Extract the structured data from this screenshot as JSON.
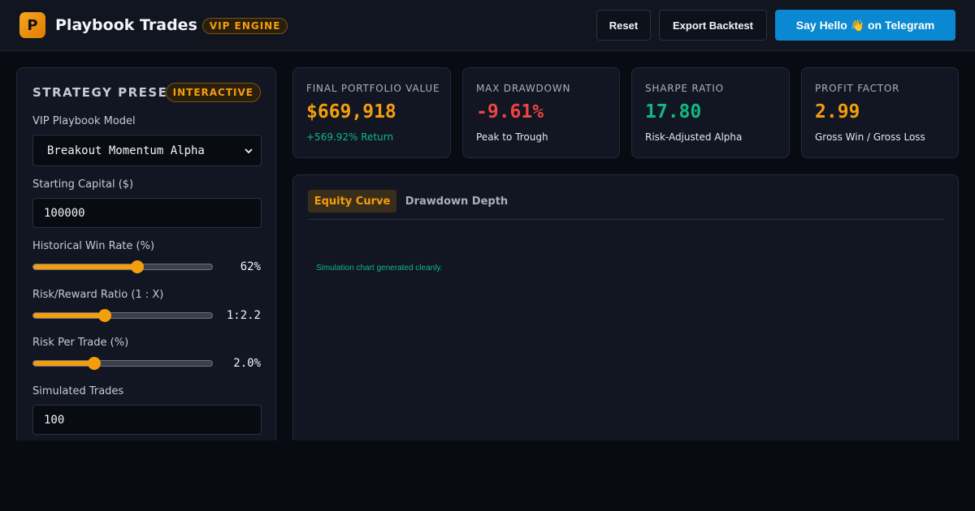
{
  "header": {
    "logo_letter": "P",
    "title": "Playbook Trades",
    "badge": "VIP ENGINE",
    "reset_label": "Reset",
    "export_label": "Export Backtest",
    "telegram_label": "Say Hello 👋 on Telegram"
  },
  "colors": {
    "accent": "#f59e0b",
    "positive": "#10b981",
    "negative": "#ef4444",
    "telegram": "#0a88d1"
  },
  "strategy": {
    "title": "STRATEGY PRESET",
    "badge": "INTERACTIVE",
    "model_label": "VIP Playbook Model",
    "model_value": "Breakout Momentum Alpha",
    "capital_label": "Starting Capital ($)",
    "capital_value": "100000",
    "win_rate_label": "Historical Win Rate (%)",
    "win_rate_value": "62%",
    "win_rate_fraction": 0.58,
    "rr_label": "Risk/Reward Ratio (1 : X)",
    "rr_value": "1:2.2",
    "rr_fraction": 0.4,
    "risk_label": "Risk Per Trade (%)",
    "risk_value": "2.0%",
    "risk_fraction": 0.34,
    "trades_label": "Simulated Trades",
    "trades_value": "100"
  },
  "kpis": [
    {
      "label": "FINAL PORTFOLIO VALUE",
      "value": "$669,918",
      "sub": "+569.92% Return",
      "value_color": "#f59e0b",
      "sub_color": "#10b981"
    },
    {
      "label": "MAX DRAWDOWN",
      "value": "-9.61%",
      "sub": "Peak to Trough",
      "value_color": "#ef4444",
      "sub_color": "#e5e7eb"
    },
    {
      "label": "SHARPE RATIO",
      "value": "17.80",
      "sub": "Risk-Adjusted Alpha",
      "value_color": "#10b981",
      "sub_color": "#e5e7eb"
    },
    {
      "label": "PROFIT FACTOR",
      "value": "2.99",
      "sub": "Gross Win / Gross Loss",
      "value_color": "#f59e0b",
      "sub_color": "#e5e7eb"
    }
  ],
  "chart": {
    "tab_active": "Equity Curve",
    "tab_2": "Drawdown Depth",
    "message": "Simulation chart generated cleanly."
  }
}
